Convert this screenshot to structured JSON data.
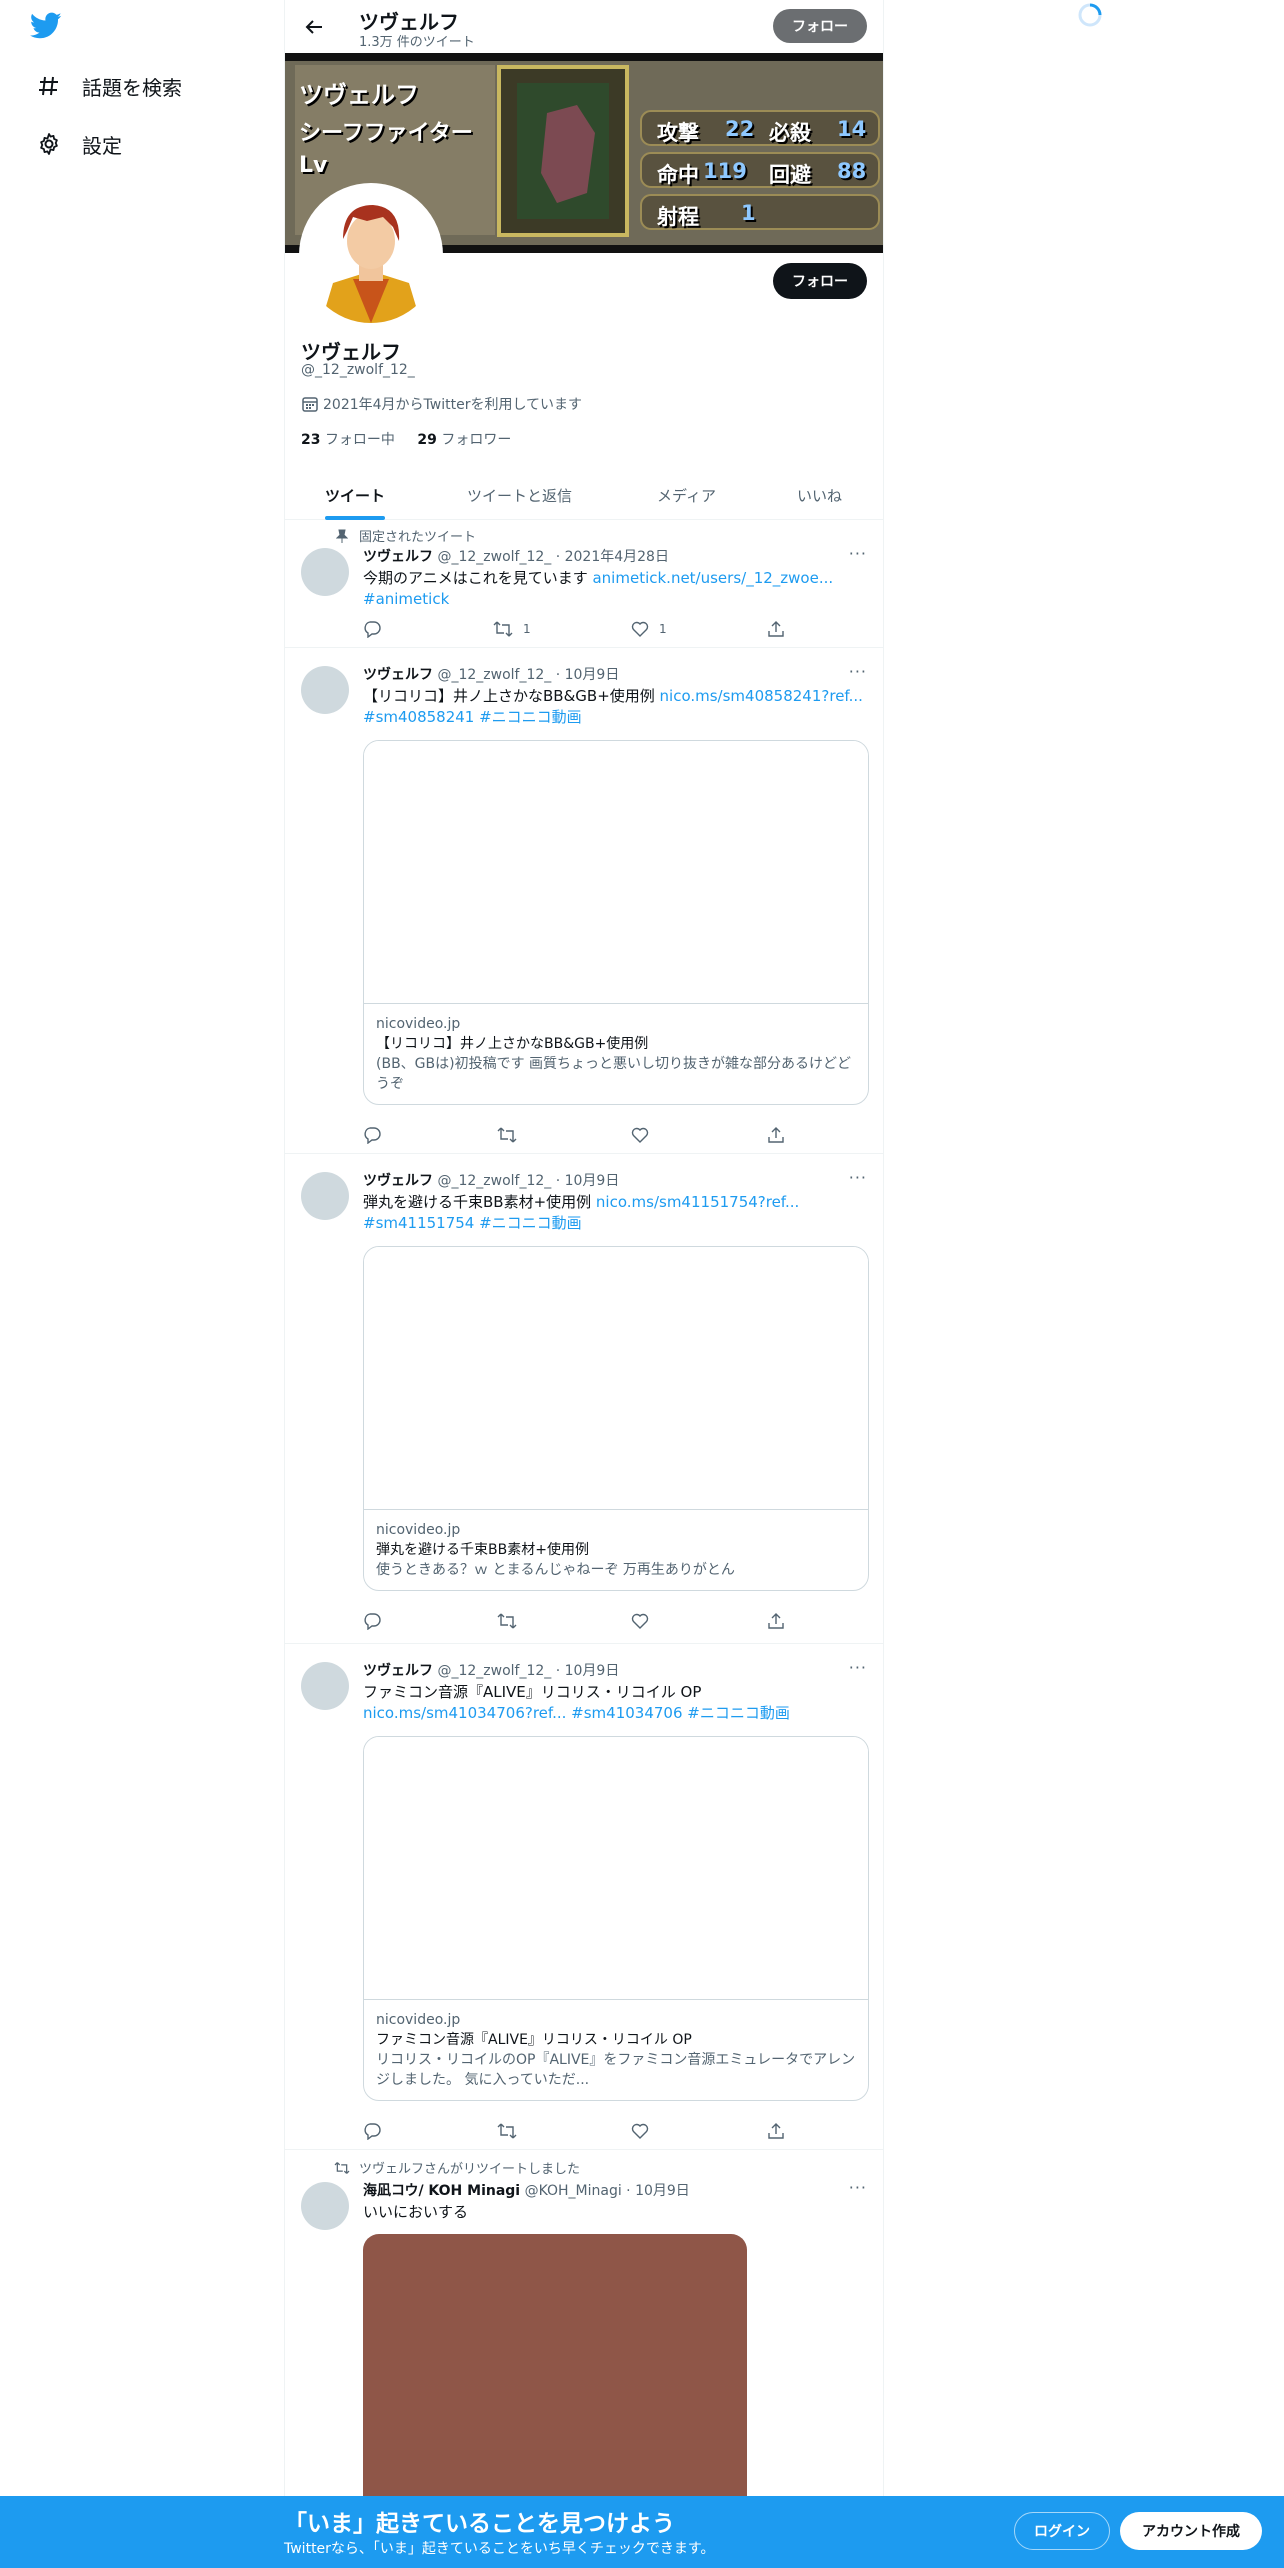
{
  "nav": {
    "explore_label": "話題を検索",
    "settings_label": "設定"
  },
  "header": {
    "name": "ツヴェルフ",
    "tweet_count": "1.3万 件のツイート",
    "follow_label": "フォロー"
  },
  "banner_text": {
    "line1": "ツヴェルフ",
    "line2": "シーフファイター",
    "line3": "Lv",
    "stat1_label": "攻撃",
    "stat1_value": "22",
    "stat2_label": "必殺",
    "stat2_value": "14",
    "stat3_label": "命中",
    "stat3_value": "119",
    "stat4_label": "回避",
    "stat4_value": "88",
    "stat5_label": "射程",
    "stat5_value": "1"
  },
  "profile": {
    "name": "ツヴェルフ",
    "handle": "@_12_zwolf_12_",
    "joined": "2021年4月からTwitterを利用しています",
    "following_count": "23",
    "following_label": "フォロー中",
    "followers_count": "29",
    "followers_label": "フォロワー",
    "follow_label": "フォロー"
  },
  "tabs": [
    "ツイート",
    "ツイートと返信",
    "メディア",
    "いいね"
  ],
  "tweets": [
    {
      "context": "固定されたツイート",
      "name": "ツヴェルフ",
      "meta": "@_12_zwolf_12_ · 2021年4月28日",
      "text": "今期のアニメはこれを見ています ",
      "link": "animetick.net/users/_12_zwoe...",
      "tags": "#animetick",
      "reply_count": "",
      "retweet_count": "1",
      "like_count": "1"
    },
    {
      "name": "ツヴェルフ",
      "meta": "@_12_zwolf_12_ · 10月9日",
      "text": "【リコリコ】井ノ上さかなBB&GB+使用例 ",
      "link": "nico.ms/sm40858241?ref...",
      "tags": "#sm40858241 #ニコニコ動画",
      "card_domain": "nicovideo.jp",
      "card_title": "【リコリコ】井ノ上さかなBB&GB+使用例",
      "card_desc": "(BB、GBは)初投稿です 画質ちょっと悪いし切り抜きが雑な部分あるけどどうぞ"
    },
    {
      "name": "ツヴェルフ",
      "meta": "@_12_zwolf_12_ · 10月9日",
      "text": "弾丸を避ける千束BB素材+使用例 ",
      "link": "nico.ms/sm41151754?ref...",
      "tags": "#sm41151754 #ニコニコ動画",
      "card_domain": "nicovideo.jp",
      "card_title": "弾丸を避ける千束BB素材+使用例",
      "card_desc": "使うときある？ｗ とまるんじゃねーぞ 万再生ありがとん"
    },
    {
      "name": "ツヴェルフ",
      "meta": "@_12_zwolf_12_ · 10月9日",
      "text": "ファミコン音源『ALIVE』リコリス・リコイル OP ",
      "link": "nico.ms/sm41034706?ref...",
      "tags": "#sm41034706 #ニコニコ動画",
      "card_domain": "nicovideo.jp",
      "card_title": "ファミコン音源『ALIVE』リコリス・リコイル OP",
      "card_desc": "リコリス・リコイルのOP『ALIVE』をファミコン音源エミュレータでアレンジしました。 気に入っていただ..."
    },
    {
      "context": "ツヴェルフさんがリツイートしました",
      "name": "海凪コウ/ KOH Minagi",
      "meta": "@KOH_Minagi · 10月9日",
      "text": "いいにおいする"
    }
  ],
  "bottom_bar": {
    "title": "「いま」起きていることを見つけよう",
    "subtitle": "Twitterなら、「いま」起きていることをいち早くチェックできます。",
    "login_label": "ログイン",
    "signup_label": "アカウント作成"
  },
  "colors": {
    "accent": "#1d9bf0",
    "text": "#0f1419",
    "secondary": "#536471"
  }
}
